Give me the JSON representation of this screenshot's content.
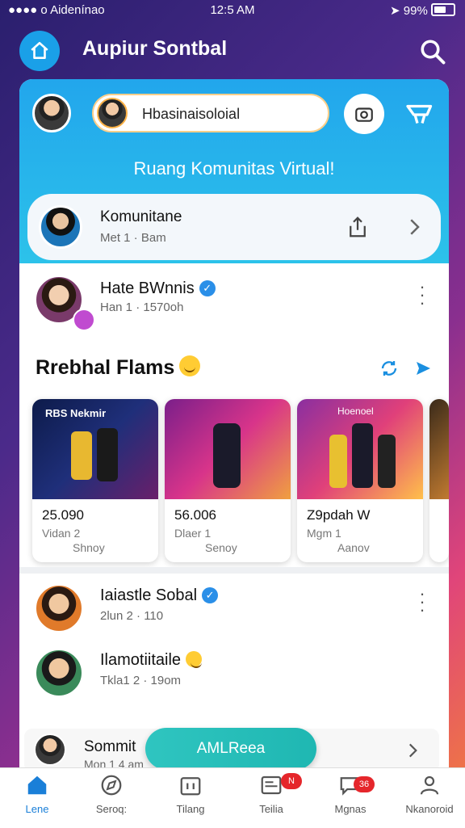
{
  "status_bar": {
    "carrier": "●●●● o Aidenínao",
    "time": "12:5 AM",
    "battery": "99%"
  },
  "app_bar": {
    "title": "Aupiur Sontbal"
  },
  "hero": {
    "search_value": "Hbasinaisoloial",
    "tagline": "Ruang Komunitas Virtual!"
  },
  "community_row": {
    "name": "Komunitane",
    "meta": "Met 1 · Bam"
  },
  "post1": {
    "name": "Hate BWnnis",
    "meta": "Han 1 · 1570oh"
  },
  "section": {
    "title": "Rrebhal Flams"
  },
  "reels": [
    {
      "banner": "RBS Nekmir",
      "value": "25.090",
      "sub": "Vidan 2",
      "sub2": "Shnoy"
    },
    {
      "banner": "",
      "value": "56.006",
      "sub": "Dlaer 1",
      "sub2": "Senoy"
    },
    {
      "banner": "Hoenoel",
      "value": "Z9pdah W",
      "sub": "Mgm 1",
      "sub2": "Aanov"
    }
  ],
  "post2": {
    "name": "Iaiastle Sobal",
    "meta": "2lun 2 · 110"
  },
  "post3": {
    "name": "Ilamotiitaile",
    "meta": "Tkla1 2 · 19om"
  },
  "float_row": {
    "name": "Sommit",
    "meta": "Mon 1 4 am"
  },
  "cta": {
    "label": "AMLReea"
  },
  "bottom_nav": [
    {
      "label": "Lene",
      "icon": "home-icon",
      "badge": ""
    },
    {
      "label": "Seroq:",
      "icon": "compass-icon",
      "badge": ""
    },
    {
      "label": "Tilang",
      "icon": "calendar-icon",
      "badge": ""
    },
    {
      "label": "Teilia",
      "icon": "news-icon",
      "badge": "N"
    },
    {
      "label": "Mgnas",
      "icon": "chat-icon",
      "badge": "36"
    },
    {
      "label": "Nkanoroid",
      "icon": "profile-icon",
      "badge": ""
    }
  ],
  "colors": {
    "accent": "#1aa0e8",
    "hero": "#22a6ec",
    "cta": "#2fc5c0",
    "badge": "#e5262b"
  }
}
